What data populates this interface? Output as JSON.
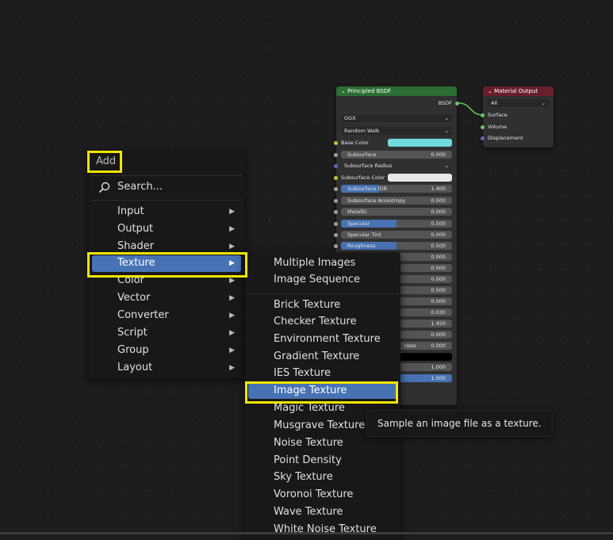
{
  "principled_node": {
    "title": "Principled BSDF",
    "output_label": "BSDF",
    "distribution": "GGX",
    "subsurface_method": "Random Walk",
    "base_color_label": "Base Color",
    "base_color_value": "#6fd9de",
    "subsurface": {
      "label": "Subsurface",
      "value": "0.000"
    },
    "subsurface_radius_label": "Subsurface Radius",
    "subsurface_color_label": "Subsurface Color",
    "subsurface_color_value": "#e8e8e8",
    "subsurface_ior": {
      "label": "Subsurface IOR",
      "value": "1.400",
      "fraction": 0.34
    },
    "subsurface_anisotropy": {
      "label": "Subsurface Anisotropy",
      "value": "0.000"
    },
    "metallic": {
      "label": "Metallic",
      "value": "0.000"
    },
    "specular": {
      "label": "Specular",
      "value": "0.500",
      "fraction": 0.5
    },
    "specular_tint": {
      "label": "Specular Tint",
      "value": "0.000"
    },
    "roughness": {
      "label": "Roughness",
      "value": "0.500",
      "fraction": 0.5
    },
    "hidden_values": [
      "0.000",
      "0.000",
      "0.000",
      "0.500",
      "0.000",
      "0.030",
      "1.450",
      "0.000"
    ],
    "partial_label": "ness",
    "partial_value": "0.000",
    "last_values": [
      "1.000",
      "1.000"
    ]
  },
  "output_node": {
    "title": "Material Output",
    "target": "All",
    "sockets": [
      "Surface",
      "Volume",
      "Displacement"
    ]
  },
  "add_menu": {
    "title": "Add",
    "search_label": "Search...",
    "items": [
      {
        "label": "Input"
      },
      {
        "label": "Output"
      },
      {
        "label": "Shader"
      },
      {
        "label": "Texture"
      },
      {
        "label": "Color"
      },
      {
        "label": "Vector"
      },
      {
        "label": "Converter"
      },
      {
        "label": "Script"
      },
      {
        "label": "Group"
      },
      {
        "label": "Layout"
      }
    ],
    "selected": "Texture"
  },
  "texture_menu": {
    "group1": [
      "Multiple Images",
      "Image Sequence"
    ],
    "group2": [
      "Brick Texture",
      "Checker Texture",
      "Environment Texture",
      "Gradient Texture",
      "IES Texture",
      "Image Texture",
      "Magic Texture",
      "Musgrave Texture",
      "Noise Texture",
      "Point Density",
      "Sky Texture",
      "Voronoi Texture",
      "Wave Texture",
      "White Noise Texture"
    ],
    "selected": "Image Texture"
  },
  "tooltip": "Sample an image file as a texture.",
  "colors": {
    "accent": "#4772b3",
    "highlight_box": "#f5e400",
    "shader_header": "#2c6e33",
    "output_header": "#6a1f2d"
  }
}
